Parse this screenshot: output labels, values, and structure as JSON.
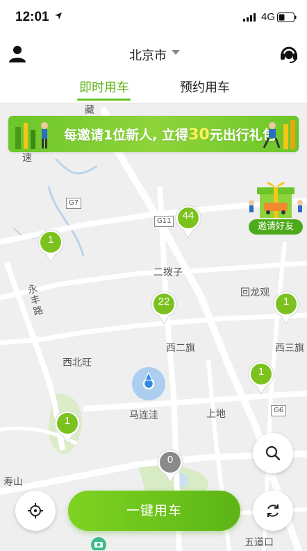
{
  "status_bar": {
    "time": "12:01",
    "network": "4G"
  },
  "header": {
    "city": "北京市"
  },
  "tabs": [
    {
      "label": "即时用车"
    },
    {
      "label": "预约用车"
    }
  ],
  "banner": {
    "text_before": "每邀请1位新人, 立得",
    "amount": "30",
    "text_after": "元出行礼包"
  },
  "invite_badge": {
    "label": "邀请好友"
  },
  "map": {
    "labels": [
      "藏",
      "速",
      "二拨子",
      "回龙观",
      "永丰路",
      "西二旗",
      "西三旗",
      "西北旺",
      "马连洼",
      "上地",
      "寿山",
      "五道口"
    ],
    "highway_signs": [
      "G7",
      "G11",
      "G6"
    ]
  },
  "clusters": [
    {
      "count": "44",
      "color": "green"
    },
    {
      "count": "1",
      "color": "green"
    },
    {
      "count": "22",
      "color": "green"
    },
    {
      "count": "1",
      "color": "green"
    },
    {
      "count": "1",
      "color": "green"
    },
    {
      "count": "1",
      "color": "green"
    },
    {
      "count": "0",
      "color": "gray"
    }
  ],
  "cta": {
    "label": "一键用车"
  },
  "colors": {
    "accent": "#66c21c",
    "pin_green": "#7cc21f",
    "pin_gray": "#8a8a8a",
    "my_location": "#2f8be0"
  }
}
